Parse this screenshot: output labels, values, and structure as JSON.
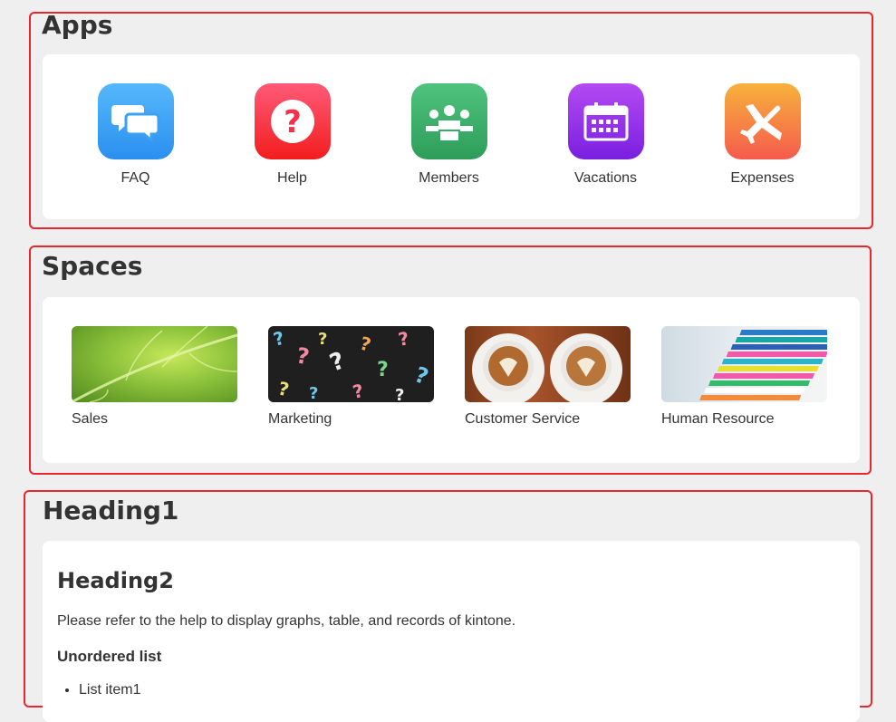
{
  "apps": {
    "title": "Apps",
    "items": [
      {
        "label": "FAQ",
        "icon": "chat-bubbles-icon",
        "color_from": "#55b8fb",
        "color_to": "#2b8fef"
      },
      {
        "label": "Help",
        "icon": "question-mark-icon",
        "color_from": "#ff5a78",
        "color_to": "#f21d1d"
      },
      {
        "label": "Members",
        "icon": "people-group-icon",
        "color_from": "#4fc37e",
        "color_to": "#2e9d5a"
      },
      {
        "label": "Vacations",
        "icon": "calendar-icon",
        "color_from": "#b44bf2",
        "color_to": "#7a1fe0"
      },
      {
        "label": "Expenses",
        "icon": "airplane-icon",
        "color_from": "#f7b23b",
        "color_to": "#f55b4d"
      }
    ]
  },
  "spaces": {
    "title": "Spaces",
    "items": [
      {
        "label": "Sales",
        "image": "green-leaf-image"
      },
      {
        "label": "Marketing",
        "image": "question-marks-chalkboard-image"
      },
      {
        "label": "Customer Service",
        "image": "coffee-cups-image"
      },
      {
        "label": "Human Resource",
        "image": "stacked-notebooks-image"
      }
    ]
  },
  "content": {
    "heading1": "Heading1",
    "heading2": "Heading2",
    "paragraph": "Please refer to the help to display graphs, table, and records of kintone.",
    "list_title": "Unordered list",
    "list_items": [
      "List item1"
    ]
  },
  "colors": {
    "section_border": "#e8262d",
    "page_background": "#efefef",
    "card_background": "#ffffff",
    "text": "#333333"
  }
}
